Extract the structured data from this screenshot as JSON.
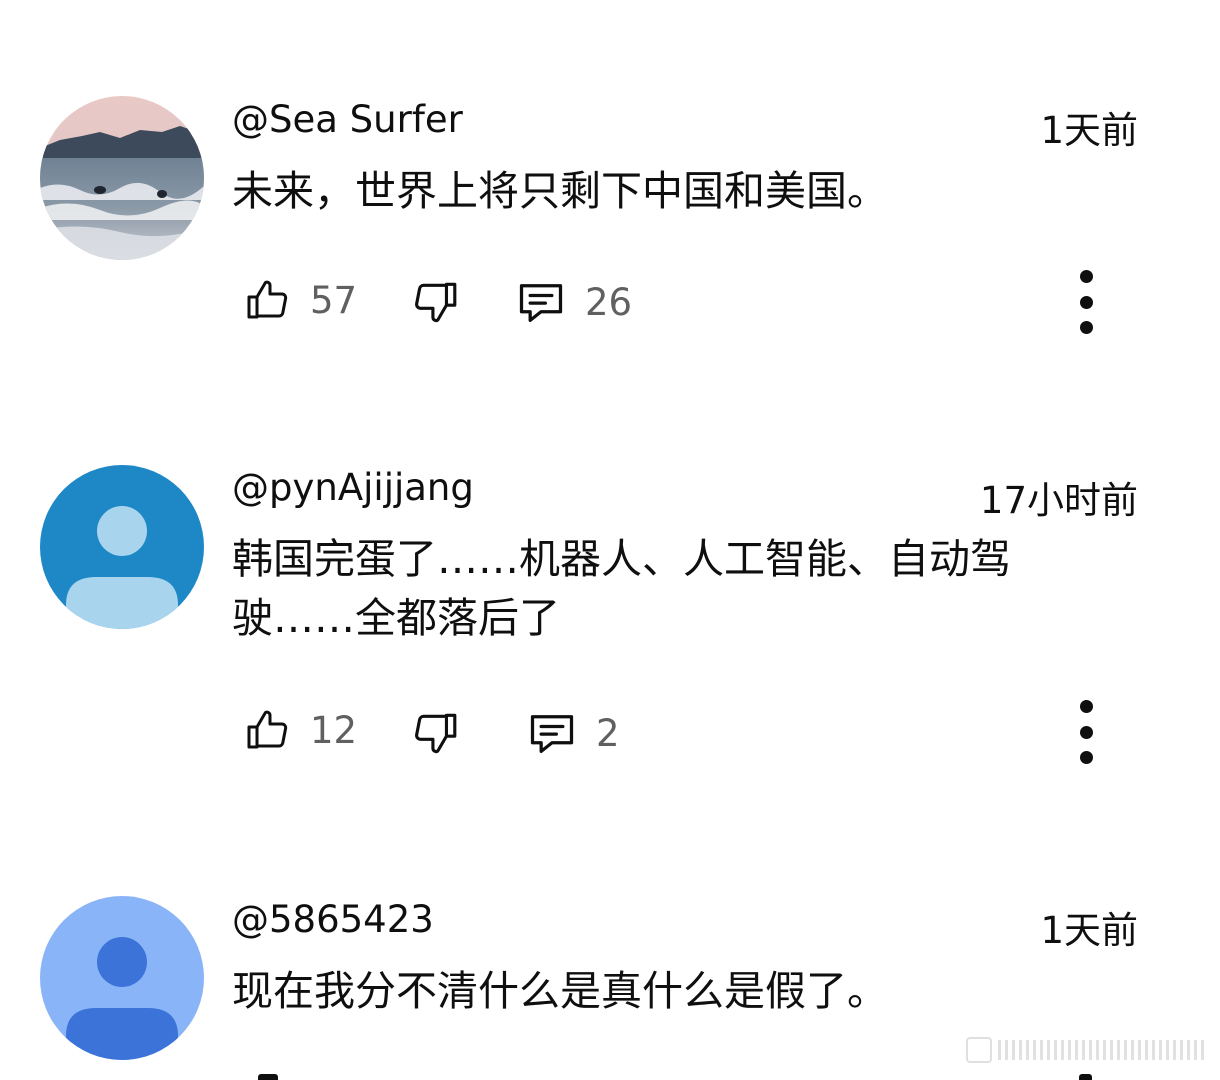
{
  "comments": [
    {
      "author": "@Sea Surfer",
      "time": "1天前",
      "text": "未来，世界上将只剩下中国和美国。",
      "likes": "57",
      "replies": "26",
      "avatar": "beach-photo"
    },
    {
      "author": "@pynAjijjang",
      "time": "17小时前",
      "text": "韩国完蛋了……机器人、人工智能、自动驾驶……全都落后了",
      "likes": "12",
      "replies": "2",
      "avatar": "default-person-blue",
      "avatar_bg": "#1e88c7",
      "avatar_fg": "#a8d4ee"
    },
    {
      "author": "@5865423",
      "time": "1天前",
      "text": "现在我分不清什么是真什么是假了。",
      "avatar": "default-person-lightblue",
      "avatar_bg": "#8ab4f8",
      "avatar_fg": "#3b73d9"
    }
  ],
  "icons": {
    "like": "thumb-up-icon",
    "dislike": "thumb-down-icon",
    "reply": "comment-icon",
    "more": "more-vertical-icon"
  },
  "watermark": "微博"
}
